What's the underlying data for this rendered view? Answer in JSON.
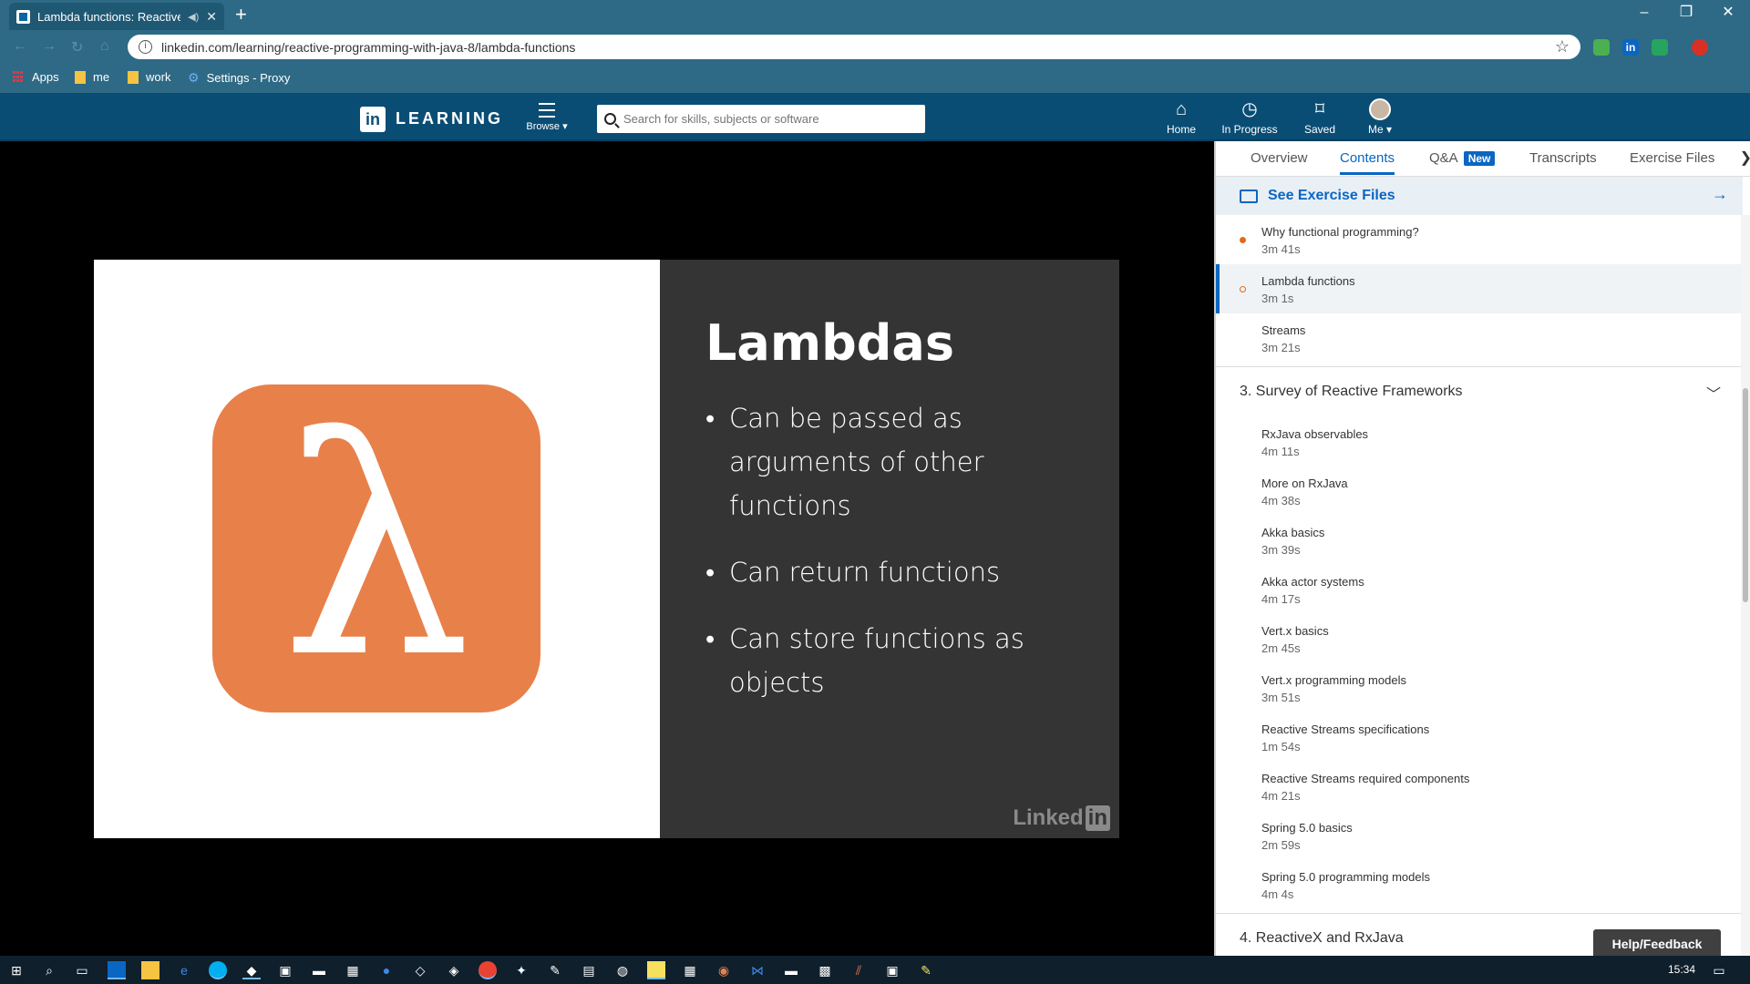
{
  "browser": {
    "tab_title": "Lambda functions: Reactive P",
    "url": "linkedin.com/learning/reactive-programming-with-java-8/lambda-functions",
    "bookmarks": [
      "Apps",
      "me",
      "work",
      "Settings - Proxy"
    ]
  },
  "header": {
    "logo_text": "LEARNING",
    "browse_label": "Browse ▾",
    "search_placeholder": "Search for skills, subjects or software",
    "nav": [
      "Home",
      "In Progress",
      "Saved",
      "Me ▾"
    ]
  },
  "slide": {
    "title": "Lambdas",
    "symbol": "λ",
    "bullets": [
      "Can be passed as arguments of other functions",
      "Can return functions",
      "Can store functions as objects"
    ],
    "watermark": "Linked",
    "watermark_in": "in"
  },
  "sidebar": {
    "tabs": [
      "Overview",
      "Contents",
      "Q&A",
      "Transcripts",
      "Exercise Files"
    ],
    "new_badge": "New",
    "exercise_label": "See Exercise Files",
    "lessons_top": [
      {
        "title": "Why functional programming?",
        "duration": "3m 41s"
      },
      {
        "title": "Lambda functions",
        "duration": "3m 1s"
      },
      {
        "title": "Streams",
        "duration": "3m 21s"
      }
    ],
    "chapter3": "3. Survey of Reactive Frameworks",
    "lessons_ch3": [
      {
        "title": "RxJava observables",
        "duration": "4m 11s"
      },
      {
        "title": "More on RxJava",
        "duration": "4m 38s"
      },
      {
        "title": "Akka basics",
        "duration": "3m 39s"
      },
      {
        "title": "Akka actor systems",
        "duration": "4m 17s"
      },
      {
        "title": "Vert.x basics",
        "duration": "2m 45s"
      },
      {
        "title": "Vert.x programming models",
        "duration": "3m 51s"
      },
      {
        "title": "Reactive Streams specifications",
        "duration": "1m 54s"
      },
      {
        "title": "Reactive Streams required components",
        "duration": "4m 21s"
      },
      {
        "title": "Spring 5.0 basics",
        "duration": "2m 59s"
      },
      {
        "title": "Spring 5.0 programming models",
        "duration": "4m 4s"
      }
    ],
    "chapter4": "4. ReactiveX and RxJava",
    "help": "Help/Feedback"
  },
  "taskbar": {
    "clock": "15:34"
  }
}
